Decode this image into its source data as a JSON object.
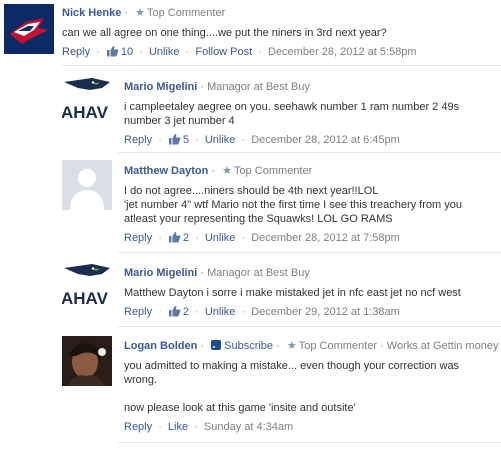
{
  "comments": [
    {
      "author": "Nick Henke",
      "role": "Top Commenter",
      "text": [
        "can we all agree on one thing....we put the niners in 3rd next year?"
      ],
      "reply": "Reply",
      "likes": "10",
      "unlike": "Unlike",
      "follow": "Follow Post",
      "timestamp": "December 28, 2012 at 5:58pm"
    },
    {
      "author": "Mario Migelini",
      "role": "Managor at Best Buy",
      "text": [
        "i campleetaley aegree on you. seehawk number 1 ram number 2 49s",
        "number 3 jet number 4"
      ],
      "reply": "Reply",
      "likes": "5",
      "unlike": "Unlike",
      "timestamp": "December 28, 2012 at 6:45pm"
    },
    {
      "author": "Matthew Dayton",
      "role": "Top Commenter",
      "text": [
        "I do not agree....niners should be 4th next year!!LOL",
        "'jet number 4\" wtf Mario not the first time I see this treachery from you",
        "atleast your representing the Squawks! LOL GO RAMS"
      ],
      "reply": "Reply",
      "likes": "2",
      "unlike": "Unlike",
      "timestamp": "December 28, 2012 at 7:58pm"
    },
    {
      "author": "Mario Migelini",
      "role": "Managor at Best Buy",
      "text": [
        "Matthew Dayton i sorre i make mistaked jet in nfc east jet no ncf west"
      ],
      "reply": "Reply",
      "likes": "2",
      "unlike": "Unlike",
      "timestamp": "December 29, 2012 at 1:38am"
    },
    {
      "author": "Logan Bolden",
      "subscribe": "Subscribe",
      "role": "Top Commenter",
      "work": "Works at Gettin money",
      "text": [
        "you admitted to making a mistake... even though your correction was",
        "wrong.",
        "",
        "now please look at this game 'insite and outsite'"
      ],
      "reply": "Reply",
      "like": "Like",
      "timestamp": "Sunday at 4:34am"
    }
  ],
  "avatars": {
    "hawk_text": "AHAV"
  },
  "separators": {
    "dot": "·"
  }
}
